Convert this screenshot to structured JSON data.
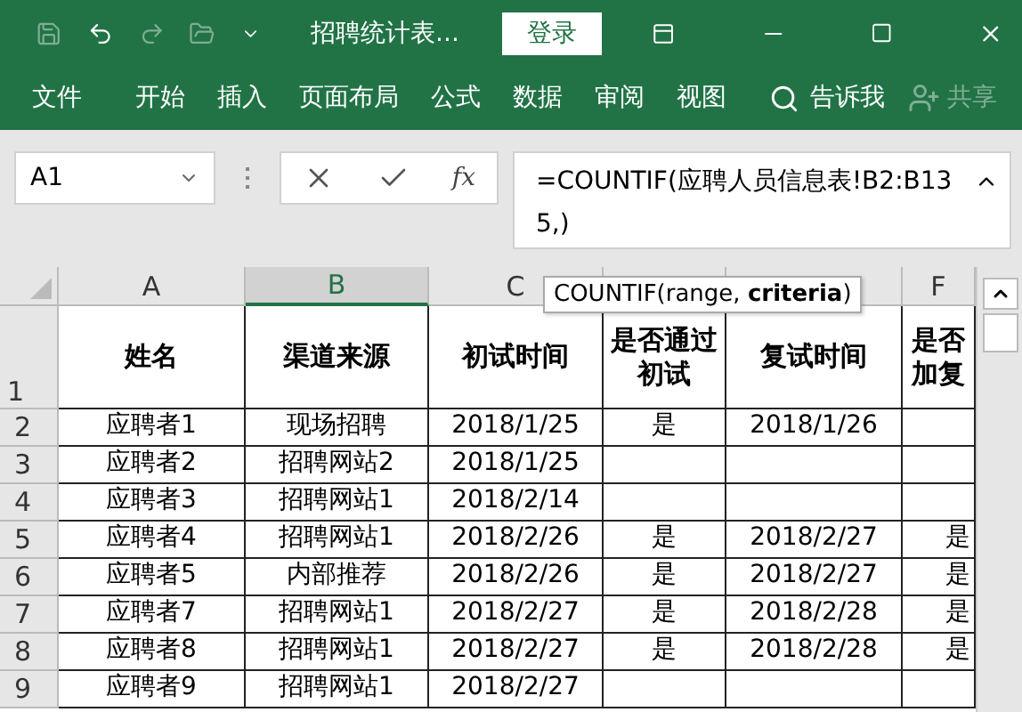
{
  "window": {
    "title": "招聘统计表...",
    "login_button": "登录"
  },
  "ribbon_tabs": [
    {
      "label": "文件"
    },
    {
      "label": "开始"
    },
    {
      "label": "插入"
    },
    {
      "label": "页面布局"
    },
    {
      "label": "公式"
    },
    {
      "label": "数据"
    },
    {
      "label": "审阅"
    },
    {
      "label": "视图"
    }
  ],
  "tell_me": "告诉我",
  "share": {
    "label": "共享",
    "disabled": true
  },
  "name_box": "A1",
  "fx_label": "fx",
  "formula": "=COUNTIF(应聘人员信息表!B2:B135,)",
  "tooltip": "COUNTIF(range, **criteria**)",
  "columns": [
    {
      "label": "A",
      "selected": false
    },
    {
      "label": "B",
      "selected": true
    },
    {
      "label": "C",
      "selected": false
    },
    {
      "selected": false
    },
    {
      "selected": false
    },
    {
      "label": "F",
      "selected": false
    }
  ],
  "header_row": {
    "number": "1",
    "cells": [
      "姓名",
      "渠道来源",
      "初试时间",
      "是否通过初试",
      "复试时间",
      "是否加复"
    ]
  },
  "rows": [
    {
      "number": "2",
      "cells": [
        "应聘者1",
        "现场招聘",
        "2018/1/25",
        "是",
        "2018/1/26",
        ""
      ]
    },
    {
      "number": "3",
      "cells": [
        "应聘者2",
        "招聘网站2",
        "2018/1/25",
        "",
        "",
        ""
      ]
    },
    {
      "number": "4",
      "cells": [
        "应聘者3",
        "招聘网站1",
        "2018/2/14",
        "",
        "",
        ""
      ]
    },
    {
      "number": "5",
      "cells": [
        "应聘者4",
        "招聘网站1",
        "2018/2/26",
        "是",
        "2018/2/27",
        "是"
      ]
    },
    {
      "number": "6",
      "cells": [
        "应聘者5",
        "内部推荐",
        "2018/2/26",
        "是",
        "2018/2/27",
        "是"
      ]
    },
    {
      "number": "7",
      "cells": [
        "应聘者7",
        "招聘网站1",
        "2018/2/27",
        "是",
        "2018/2/28",
        "是"
      ]
    },
    {
      "number": "8",
      "cells": [
        "应聘者8",
        "招聘网站1",
        "2018/2/27",
        "是",
        "2018/2/28",
        "是"
      ]
    },
    {
      "number": "9",
      "cells": [
        "应聘者9",
        "招聘网站1",
        "2018/2/27",
        "",
        "",
        ""
      ]
    }
  ]
}
